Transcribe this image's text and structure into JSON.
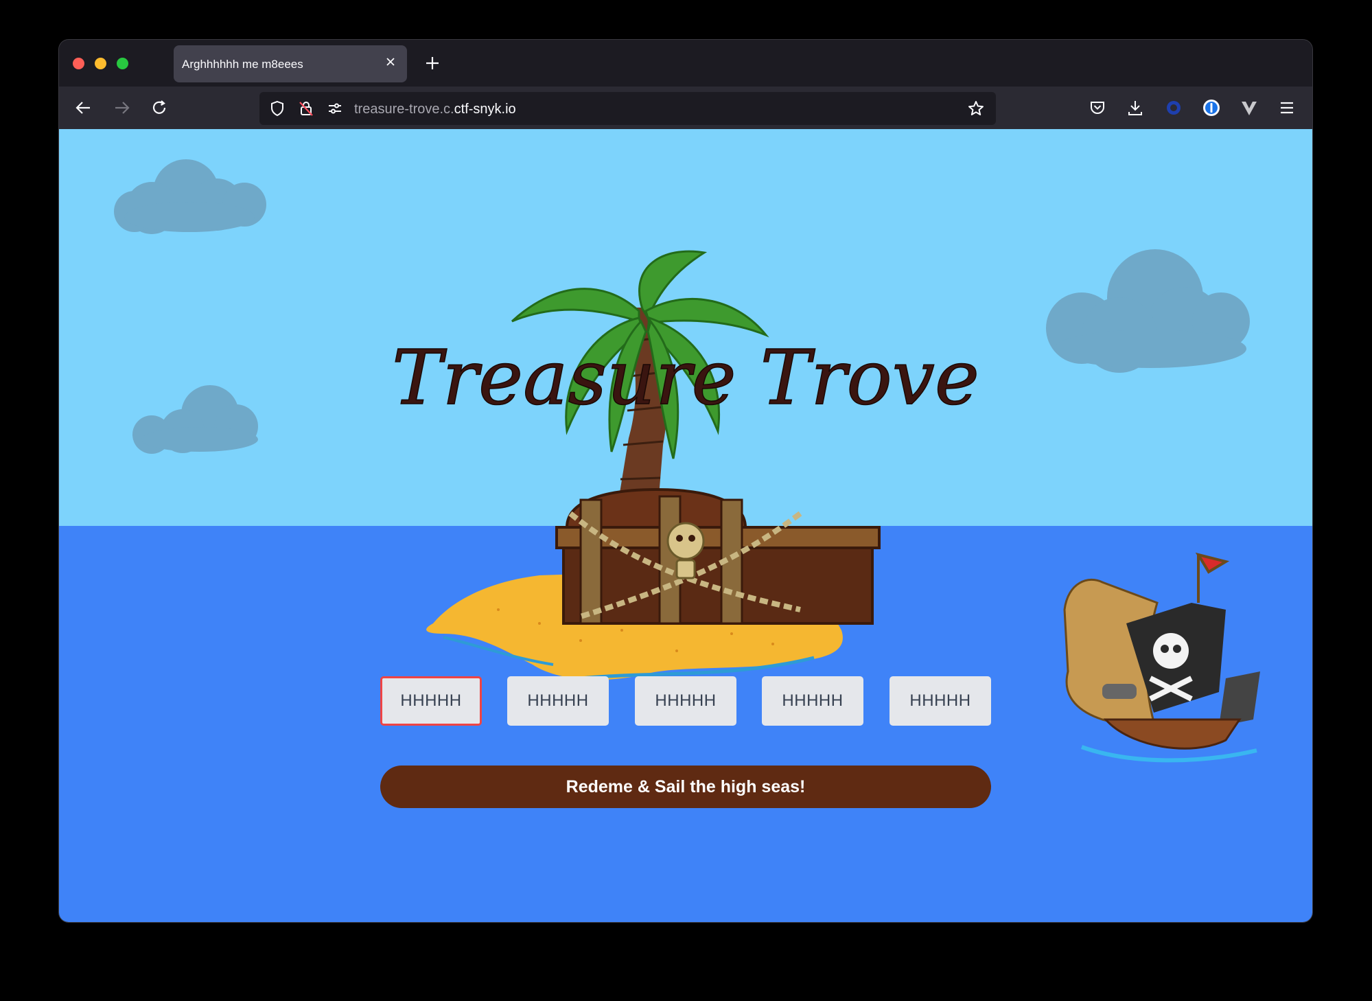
{
  "browser": {
    "tab": {
      "title": "Arghhhhhh me m8eees"
    },
    "address": {
      "host_prefix": "treasure-trove.c.",
      "host_domain": "ctf-snyk.io"
    }
  },
  "page": {
    "logo_text": "Treasure Trove",
    "code_inputs": [
      {
        "placeholder": "HHHHH",
        "value": ""
      },
      {
        "placeholder": "HHHHH",
        "value": ""
      },
      {
        "placeholder": "HHHHH",
        "value": ""
      },
      {
        "placeholder": "HHHHH",
        "value": ""
      },
      {
        "placeholder": "HHHHH",
        "value": ""
      }
    ],
    "redeem_button": "Redeme & Sail the high seas!"
  },
  "colors": {
    "sky": "#7dd3fc",
    "sea": "#3f83f8",
    "button": "#5f2a12",
    "focus_border": "#ef4444"
  },
  "icons": [
    "back-arrow-icon",
    "forward-arrow-icon",
    "reload-icon",
    "shield-icon",
    "lock-slash-icon",
    "permissions-icon",
    "bookmark-star-icon",
    "pocket-icon",
    "download-icon",
    "extension-icon",
    "password-manager-icon",
    "extension-v-icon",
    "menu-icon",
    "close-icon",
    "plus-icon"
  ]
}
